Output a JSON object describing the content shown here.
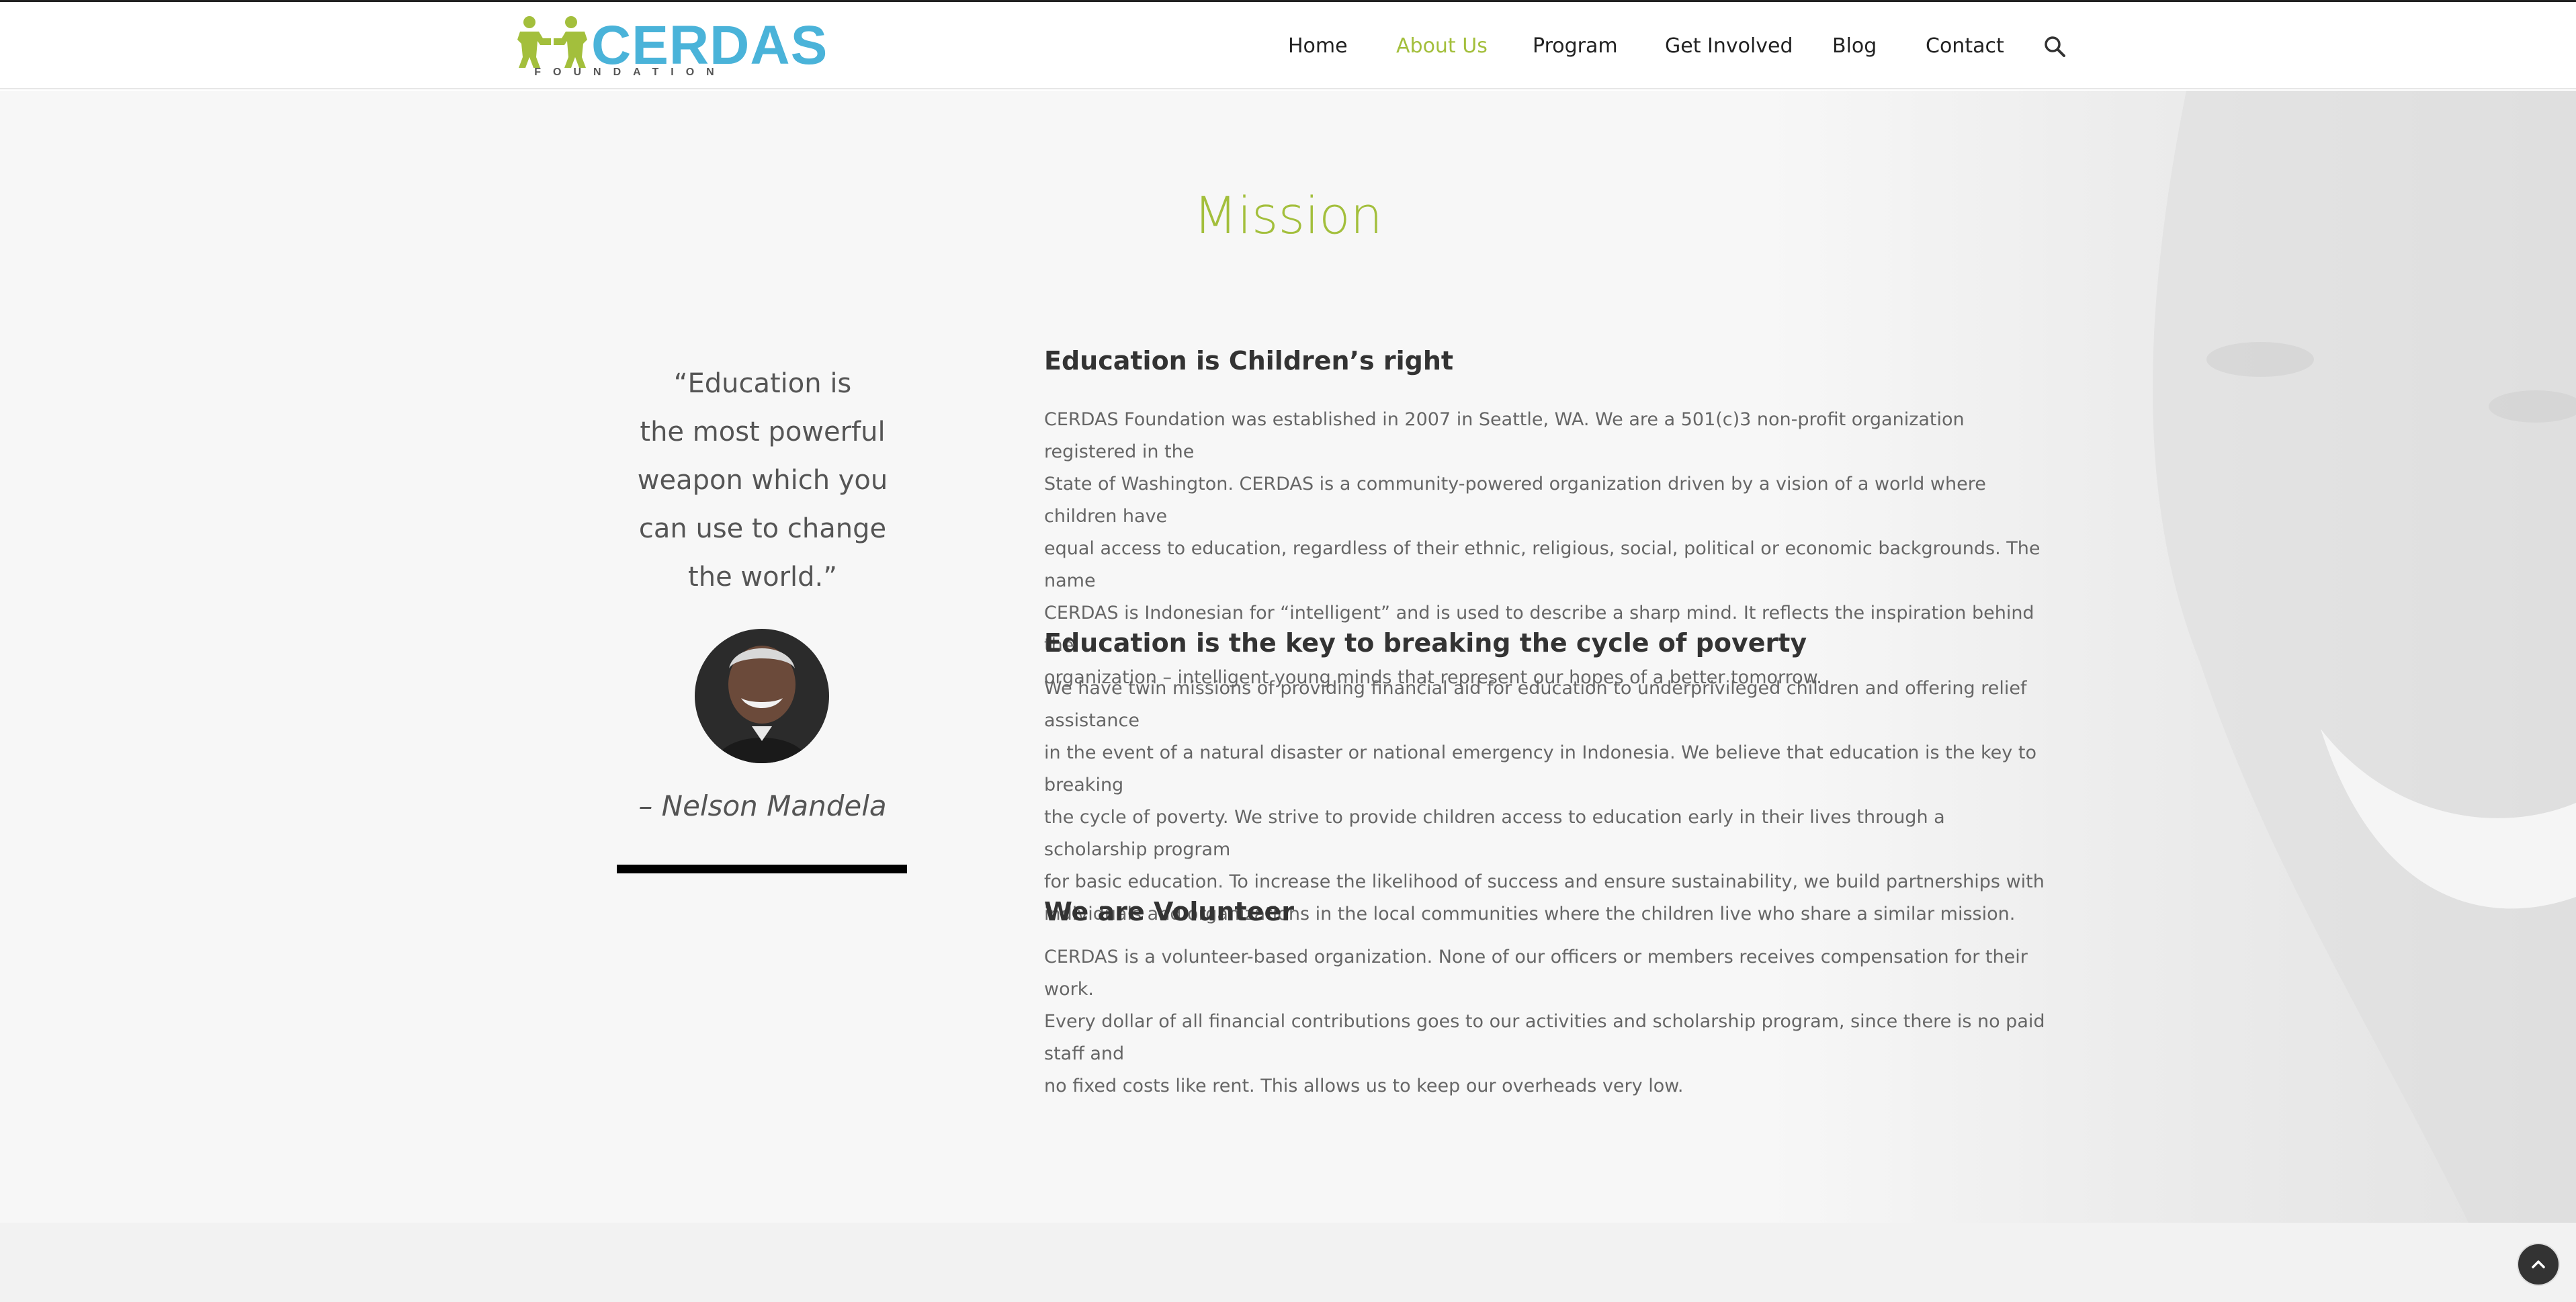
{
  "header": {
    "logo": {
      "name": "CERDAS",
      "subtitle": "FOUNDATION"
    },
    "nav": [
      {
        "label": "Home",
        "active": false
      },
      {
        "label": "About Us",
        "active": true
      },
      {
        "label": "Program",
        "active": false
      },
      {
        "label": "Get Involved",
        "active": false
      },
      {
        "label": "Blog",
        "active": false
      },
      {
        "label": "Contact",
        "active": false
      }
    ],
    "search_icon": "search-icon"
  },
  "main": {
    "title": "Mission",
    "quote": {
      "lines": [
        "“Education is",
        "the most powerful",
        "weapon which you",
        "can use to change",
        "the world.”"
      ],
      "author": "– Nelson Mandela"
    },
    "sections": [
      {
        "heading": "Education is Children’s right",
        "lines": [
          "CERDAS Foundation was established in 2007 in Seattle, WA. We are a 501(c)3 non-profit organization registered in the",
          "State of Washington. CERDAS is a community-powered organization driven by a vision of a world where children have",
          "equal access to education, regardless of their ethnic, religious, social, political or economic backgrounds. The name",
          "CERDAS is Indonesian for “intelligent” and is used to describe a sharp mind. It reflects the inspiration behind the",
          "organization – intelligent young minds that represent our hopes of a better tomorrow."
        ]
      },
      {
        "heading": "Education is the key to breaking the cycle of poverty",
        "lines": [
          "We have twin missions of providing financial aid for education to underprivileged children and offering relief assistance",
          "in the event of a natural disaster or national emergency in Indonesia. We believe that education is the key to breaking",
          "the cycle of poverty. We strive to provide children access to education early in their lives through a scholarship program",
          "for basic education. To increase the likelihood of success and ensure sustainability, we build partnerships with",
          "individuals and organizations in the local communities where the children live who share a similar mission."
        ]
      },
      {
        "heading": "We are Volunteer",
        "lines": [
          "CERDAS is a volunteer-based organization. None of our officers or members receives compensation for their work.",
          "Every dollar of all financial contributions goes to our activities and scholarship program, since there is no paid staff and",
          "no fixed costs like rent. This allows us to keep our overheads very low."
        ]
      }
    ]
  },
  "colors": {
    "accent": "#a3bf3c",
    "logo_blue": "#4ab3d9",
    "text": "#666666",
    "heading": "#333333"
  },
  "scroll_top_icon": "chevron-up-icon"
}
